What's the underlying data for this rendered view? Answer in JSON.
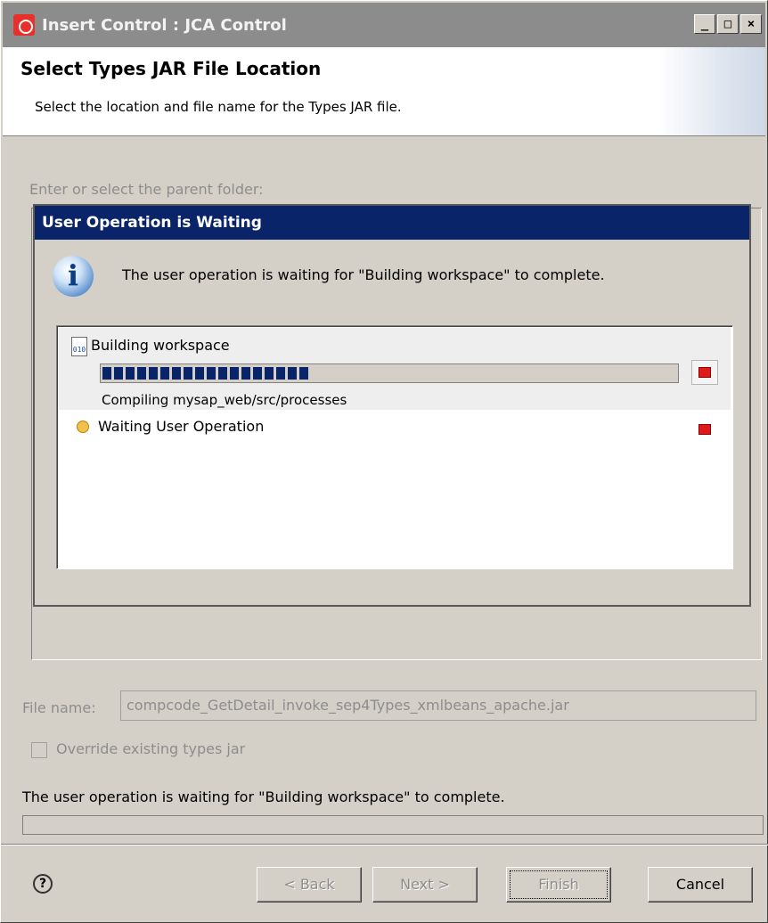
{
  "window": {
    "title": "Insert Control : JCA Control",
    "controls": {
      "minimize": "_",
      "maximize": "□",
      "close": "×"
    }
  },
  "banner": {
    "title": "Select Types JAR File Location",
    "description": "Select the location and file name for the Types JAR file."
  },
  "parent_folder_label": "Enter or select the parent folder:",
  "progress_dialog": {
    "title": "User Operation is Waiting",
    "message": "The user operation is waiting for \"Building workspace\" to complete.",
    "jobs": [
      {
        "name": "Building workspace",
        "detail": "Compiling mysap_web/src/processes",
        "progress_percent": 36,
        "icon": "binary-file-icon"
      },
      {
        "name": "Waiting User Operation",
        "icon": "waiting-icon"
      }
    ]
  },
  "file_name": {
    "label": "File name:",
    "value": "compcode_GetDetail_invoke_sep4Types_xmlbeans_apache.jar"
  },
  "override_checkbox": {
    "label": "Override existing types jar",
    "checked": false
  },
  "status_message": "The user operation is waiting for \"Building workspace\" to complete.",
  "buttons": {
    "help": "?",
    "back": "< Back",
    "next": "Next >",
    "finish": "Finish",
    "cancel": "Cancel"
  },
  "colors": {
    "title_bar_inactive": "#8c8c8c",
    "progress_title": "#0a246a",
    "progress_fill": "#0a246a",
    "stop_red": "#e01a1a"
  }
}
